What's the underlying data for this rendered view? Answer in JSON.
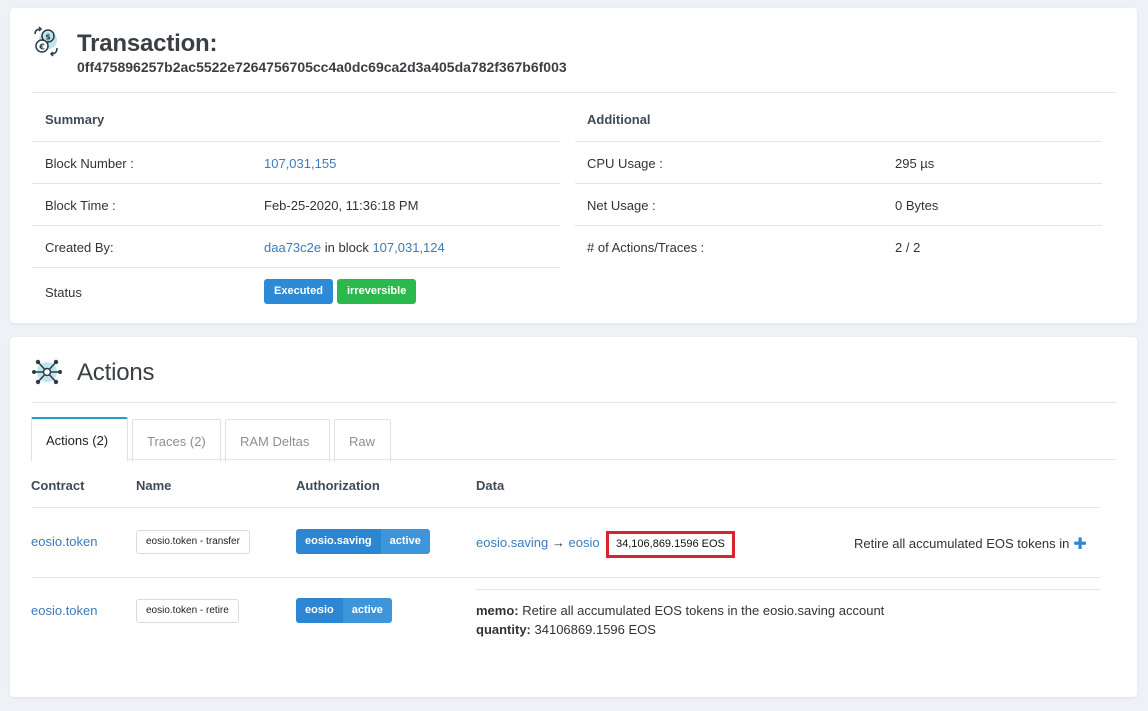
{
  "transaction": {
    "title": "Transaction:",
    "hash": "0ff475896257b2ac5522e7264756705cc4a0dc69ca2d3a405da782f367b6f003",
    "summary": {
      "heading": "Summary",
      "block_number_label": "Block Number :",
      "block_number": "107,031,155",
      "block_time_label": "Block Time :",
      "block_time": "Feb-25-2020, 11:36:18 PM",
      "created_by_label": "Created By:",
      "created_by_producer": "daa73c2e",
      "created_by_in_block": "in block",
      "created_by_block": "107,031,124",
      "status_label": "Status",
      "status_executed": "Executed",
      "status_irreversible": "irreversible"
    },
    "additional": {
      "heading": "Additional",
      "cpu_label": "CPU Usage :",
      "cpu_value": "295 µs",
      "net_label": "Net Usage :",
      "net_value": "0 Bytes",
      "actions_label": "# of Actions/Traces :",
      "actions_value": "2 / 2"
    }
  },
  "actions": {
    "title": "Actions",
    "tabs": [
      {
        "label": "Actions (2)",
        "active": true
      },
      {
        "label": "Traces (2)",
        "active": false
      },
      {
        "label": "RAM Deltas",
        "active": false
      },
      {
        "label": "Raw",
        "active": false
      }
    ],
    "columns": {
      "contract": "Contract",
      "name": "Name",
      "authorization": "Authorization",
      "data": "Data"
    },
    "rows": [
      {
        "contract": "eosio.token",
        "name": "eosio.token - transfer",
        "auth_actor": "eosio.saving",
        "auth_permission": "active",
        "from": "eosio.saving",
        "arrow": "→",
        "to": "eosio",
        "quantity": "34,106,869.1596 EOS",
        "memo_preview": "Retire all accumulated EOS tokens in"
      },
      {
        "contract": "eosio.token",
        "name": "eosio.token - retire",
        "auth_actor": "eosio",
        "auth_permission": "active",
        "memo_label": "memo:",
        "memo": "Retire all accumulated EOS tokens in the eosio.saving account",
        "quantity_label": "quantity:",
        "quantity": "34106869.1596 EOS"
      }
    ]
  },
  "icons": {
    "transaction": "currency-exchange-icon",
    "actions": "network-nodes-icon",
    "expand": "plus-icon"
  },
  "colors": {
    "link": "#3b7bbf",
    "badge_blue": "#2d8ad6",
    "badge_green": "#2bb84d",
    "highlight": "#d9232e",
    "tab_accent": "#1fa3c6"
  }
}
